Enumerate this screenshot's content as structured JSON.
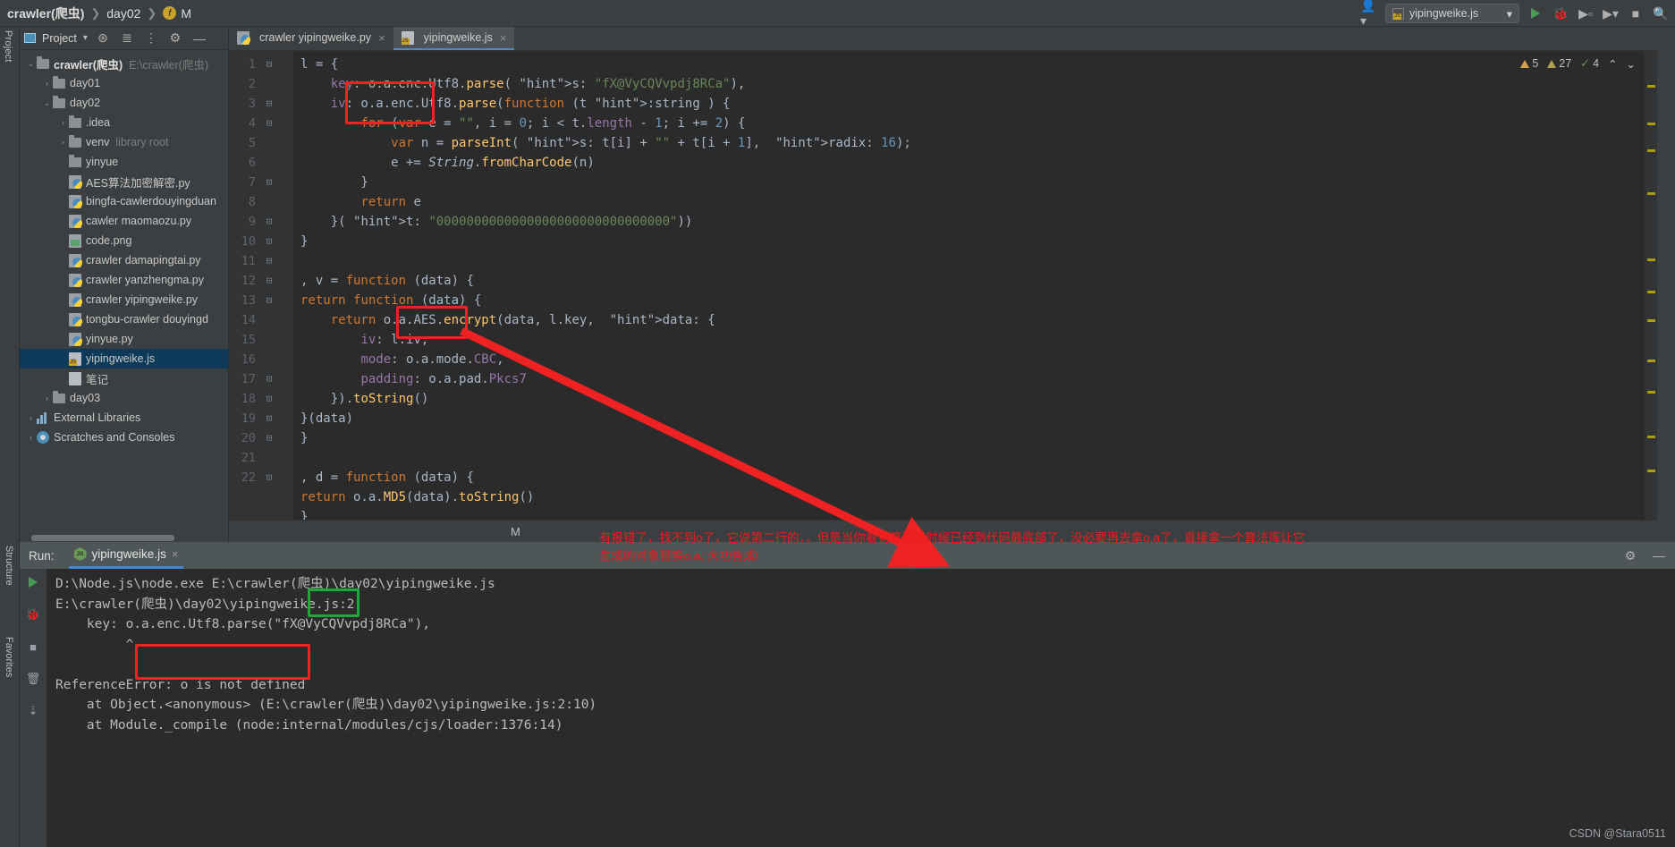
{
  "breadcrumb": {
    "project": "crawler(爬虫)",
    "folder": "day02",
    "symbol": "M",
    "fn_badge": "f",
    "sep": "❯"
  },
  "top_toolbar": {
    "user_icon": "user-icon",
    "run_config": "yipingweike.js",
    "chevron": "▾",
    "run": "run-icon",
    "debug": "debug-icon",
    "coverage": "coverage-icon",
    "profile": "profile-icon",
    "stop": "stop-icon",
    "search": "search-icon"
  },
  "project_panel": {
    "title": "Project",
    "chevron": "▾",
    "icons": [
      "locate-icon",
      "collapse-all-icon",
      "expand-all-icon",
      "settings-gear-icon",
      "hide-icon"
    ],
    "tree": [
      {
        "depth": 0,
        "arrow": "⌄",
        "icon": "folder",
        "label": "crawler(爬虫)",
        "bold": true,
        "hint": "E:\\crawler(爬虫)"
      },
      {
        "depth": 1,
        "arrow": "›",
        "icon": "folder",
        "label": "day01",
        "bold": false,
        "hint": ""
      },
      {
        "depth": 1,
        "arrow": "⌄",
        "icon": "folder",
        "label": "day02",
        "bold": false,
        "hint": ""
      },
      {
        "depth": 2,
        "arrow": "›",
        "icon": "folder",
        "label": ".idea",
        "bold": false,
        "hint": ""
      },
      {
        "depth": 2,
        "arrow": "›",
        "icon": "folder",
        "label": "venv",
        "bold": false,
        "hint": "library root"
      },
      {
        "depth": 2,
        "arrow": "",
        "icon": "folder",
        "label": "yinyue",
        "bold": false,
        "hint": ""
      },
      {
        "depth": 2,
        "arrow": "",
        "icon": "py",
        "label": "AES算法加密解密.py",
        "bold": false,
        "hint": ""
      },
      {
        "depth": 2,
        "arrow": "",
        "icon": "py",
        "label": "bingfa-cawlerdouyingduan",
        "bold": false,
        "hint": ""
      },
      {
        "depth": 2,
        "arrow": "",
        "icon": "py",
        "label": "cawler maomaozu.py",
        "bold": false,
        "hint": ""
      },
      {
        "depth": 2,
        "arrow": "",
        "icon": "img",
        "label": "code.png",
        "bold": false,
        "hint": ""
      },
      {
        "depth": 2,
        "arrow": "",
        "icon": "py",
        "label": "crawler damapingtai.py",
        "bold": false,
        "hint": ""
      },
      {
        "depth": 2,
        "arrow": "",
        "icon": "py",
        "label": "crawler yanzhengma.py",
        "bold": false,
        "hint": ""
      },
      {
        "depth": 2,
        "arrow": "",
        "icon": "py",
        "label": "crawler yipingweike.py",
        "bold": false,
        "hint": ""
      },
      {
        "depth": 2,
        "arrow": "",
        "icon": "py",
        "label": "tongbu-crawler douyingd",
        "bold": false,
        "hint": ""
      },
      {
        "depth": 2,
        "arrow": "",
        "icon": "py",
        "label": "yinyue.py",
        "bold": false,
        "hint": ""
      },
      {
        "depth": 2,
        "arrow": "",
        "icon": "js",
        "label": "yipingweike.js",
        "bold": false,
        "hint": "",
        "selected": true
      },
      {
        "depth": 2,
        "arrow": "",
        "icon": "txt",
        "label": "笔记",
        "bold": false,
        "hint": ""
      },
      {
        "depth": 1,
        "arrow": "›",
        "icon": "folder",
        "label": "day03",
        "bold": false,
        "hint": ""
      },
      {
        "depth": 0,
        "arrow": "›",
        "icon": "lib",
        "label": "External Libraries",
        "bold": false,
        "hint": ""
      },
      {
        "depth": 0,
        "arrow": "›",
        "icon": "console",
        "label": "Scratches and Consoles",
        "bold": false,
        "hint": ""
      }
    ]
  },
  "left_strip_label": "Project",
  "editor": {
    "tabs": [
      {
        "label": "crawler yipingweike.py",
        "icon": "py",
        "active": false
      },
      {
        "label": "yipingweike.js",
        "icon": "js",
        "active": true
      }
    ],
    "status_symbol": "M",
    "inspections": {
      "warnings": "5",
      "weak_warnings": "27",
      "typos": "4",
      "chevron_up": "⌃",
      "chevron_down": "⌄"
    },
    "lines": [
      {
        "n": "1",
        "fold": "⊟"
      },
      {
        "n": "2",
        "fold": ""
      },
      {
        "n": "3",
        "fold": "⊟"
      },
      {
        "n": "4",
        "fold": "⊟"
      },
      {
        "n": "5",
        "fold": ""
      },
      {
        "n": "6",
        "fold": ""
      },
      {
        "n": "7",
        "fold": "⊡"
      },
      {
        "n": "8",
        "fold": ""
      },
      {
        "n": "9",
        "fold": "⊡"
      },
      {
        "n": "10",
        "fold": "⊡"
      },
      {
        "n": "11",
        "fold": "⊟"
      },
      {
        "n": "12",
        "fold": "⊟"
      },
      {
        "n": "13",
        "fold": "⊟"
      },
      {
        "n": "14",
        "fold": ""
      },
      {
        "n": "15",
        "fold": ""
      },
      {
        "n": "16",
        "fold": ""
      },
      {
        "n": "17",
        "fold": "⊡"
      },
      {
        "n": "18",
        "fold": "⊡"
      },
      {
        "n": "19",
        "fold": "⊡"
      },
      {
        "n": "20",
        "fold": "⊟"
      },
      {
        "n": "21",
        "fold": ""
      },
      {
        "n": "22",
        "fold": "⊡"
      }
    ],
    "code_text": [
      "l = {",
      "    key: o.a.enc.Utf8.parse( s: \"fX@VyCQVvpdj8RCa\"),",
      "    iv: o.a.enc.Utf8.parse(function (t :string ) {",
      "        for (var e = \"\", i = 0; i < t.length - 1; i += 2) {",
      "            var n = parseInt( s: t[i] + \"\" + t[i + 1],  radix: 16);",
      "            e += String.fromCharCode(n)",
      "        }",
      "        return e",
      "    }( t: \"0000000000000000000000000000000\"))",
      "}",
      "",
      ", v = function (data) {",
      "return function (data) {",
      "    return o.a.AES.encrypt(data, l.key,  data: {",
      "        iv: l.iv,",
      "        mode: o.a.mode.CBC,",
      "        padding: o.a.pad.Pkcs7",
      "    }).toString()",
      "}(data)",
      "}",
      "",
      ", d = function (data) {",
      "return o.a.MD5(data).toString()",
      "}"
    ]
  },
  "run_panel": {
    "label": "Run:",
    "tab": "yipingweike.js",
    "close": "×",
    "settings_icon": "gear-icon",
    "hide_icon": "minimize-icon",
    "actions": [
      "rerun-icon",
      "debug-icon",
      "stop-icon",
      "trash-icon",
      "scroll-icon"
    ],
    "console_lines": [
      "D:\\Node.js\\node.exe E:\\crawler(爬虫)\\day02\\yipingweike.js",
      "E:\\crawler(爬虫)\\day02\\yipingweike.js:2",
      "    key: o.a.enc.Utf8.parse(\"fX@VyCQVvpdj8RCa\"),",
      "         ^",
      "",
      "ReferenceError: o is not defined",
      "    at Object.<anonymous> (E:\\crawler(爬虫)\\day02\\yipingweike.js:2:10)",
      "    at Module._compile (node:internal/modules/cjs/loader:1376:14)"
    ]
  },
  "structure_label": "Structure",
  "favorites_label": "Favorites",
  "annotation": {
    "line1": "有报错了，找不到o了，它说第二行的，，但是当你看到算法的时候已经到代码最底部了，没必要再去拿o.a了，直接拿一个算法库让它",
    "line2": "生成的对象替换o.a; 大功告成!",
    "color": "#ee1b1b"
  },
  "watermark": "CSDN @Stara0511",
  "colors": {
    "red_box": "#ee2222",
    "green_box": "#22a83a",
    "selection_blue": "#0d3a58",
    "tab_underline": "#3d87d8"
  }
}
